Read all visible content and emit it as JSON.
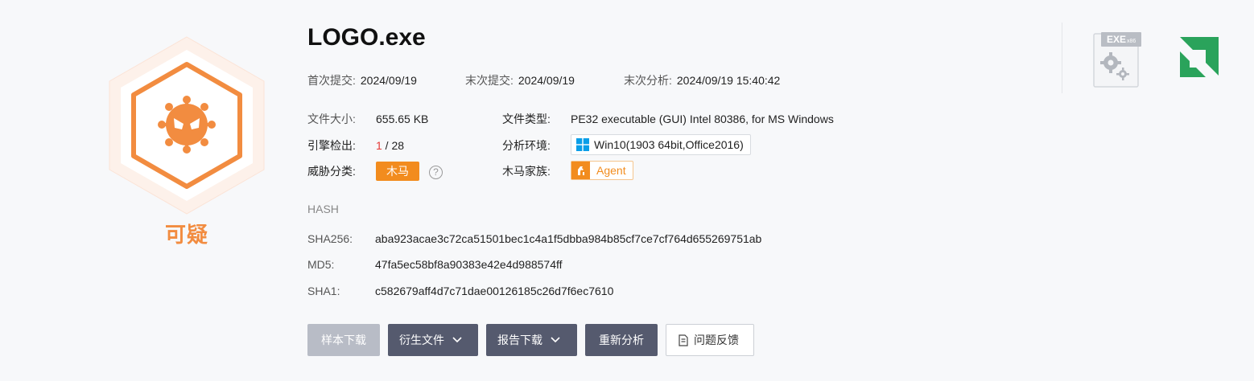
{
  "verdict": {
    "label": "可疑",
    "color": "#f28c40"
  },
  "file": {
    "name": "LOGO.exe"
  },
  "meta": {
    "first_submit_label": "首次提交:",
    "first_submit": "2024/09/19",
    "last_submit_label": "末次提交:",
    "last_submit": "2024/09/19",
    "last_analysis_label": "末次分析:",
    "last_analysis": "2024/09/19 15:40:42"
  },
  "details": {
    "size_label": "文件大小:",
    "size": "655.65 KB",
    "type_label": "文件类型:",
    "type": "PE32 executable (GUI) Intel 80386, for MS Windows",
    "engine_label": "引擎检出:",
    "engine_detected": "1",
    "engine_total": " / 28",
    "env_label": "分析环境:",
    "env": "Win10(1903 64bit,Office2016)",
    "threat_label": "威胁分类:",
    "threat": "木马",
    "family_label": "木马家族:",
    "family": "Agent"
  },
  "hash": {
    "heading": "HASH",
    "sha256_label": "SHA256:",
    "sha256": "aba923acae3c72ca51501bec1c4a1f5dbba984b85cf7ce7cf764d655269751ab",
    "md5_label": "MD5:",
    "md5": "47fa5ec58bf8a90383e42e4d988574ff",
    "sha1_label": "SHA1:",
    "sha1": "c582679aff4d7c71dae00126185c26d7f6ec7610"
  },
  "actions": {
    "sample_download": "样本下载",
    "derived_files": "衍生文件",
    "report_download": "报告下载",
    "reanalyze": "重新分析",
    "feedback": "问题反馈"
  },
  "file_icon": {
    "label": "EXE",
    "sublabel": "x86"
  },
  "icons": {
    "verdict": "virus-hexagon-icon",
    "help": "question-circle-icon",
    "windows": "windows-icon",
    "family": "trojan-horse-icon",
    "chevron": "chevron-down-icon",
    "feedback": "document-icon",
    "file_type": "exe-gear-file-icon",
    "brand": "green-brand-logo-icon"
  }
}
